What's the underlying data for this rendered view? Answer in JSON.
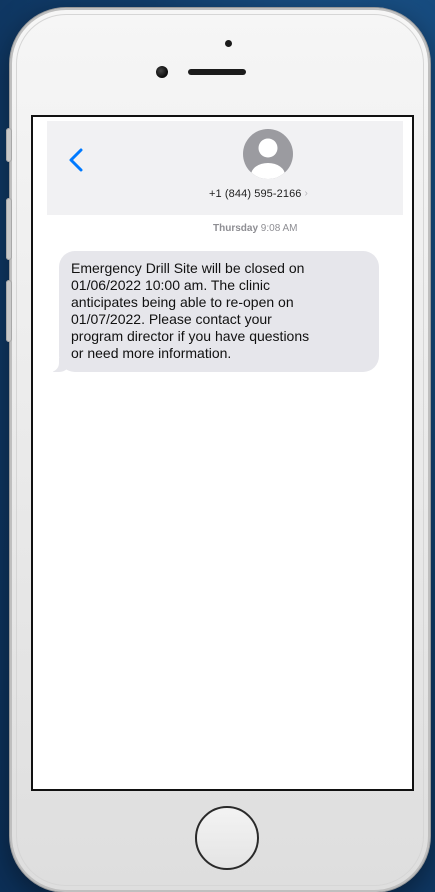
{
  "contact": {
    "phone_number": "+1 (844) 595-2166",
    "detail_chevron": "›"
  },
  "conversation": {
    "timestamp_day": "Thursday",
    "timestamp_time": "9:08 AM",
    "messages": [
      {
        "direction": "incoming",
        "lines": [
          "Emergency Drill Site will be closed on",
          "01/06/2022 10:00 am.  The clinic",
          "anticipates being able to re-open on",
          "01/07/2022.  Please contact your",
          "program director if you have questions",
          "or need more information."
        ]
      }
    ]
  },
  "icons": {
    "back": "chevron-left-icon",
    "avatar": "person-icon"
  },
  "colors": {
    "accent": "#007aff",
    "bubble_incoming": "#e6e6eb",
    "nav_background": "#f1f1f3",
    "backdrop": "#123f6e"
  }
}
